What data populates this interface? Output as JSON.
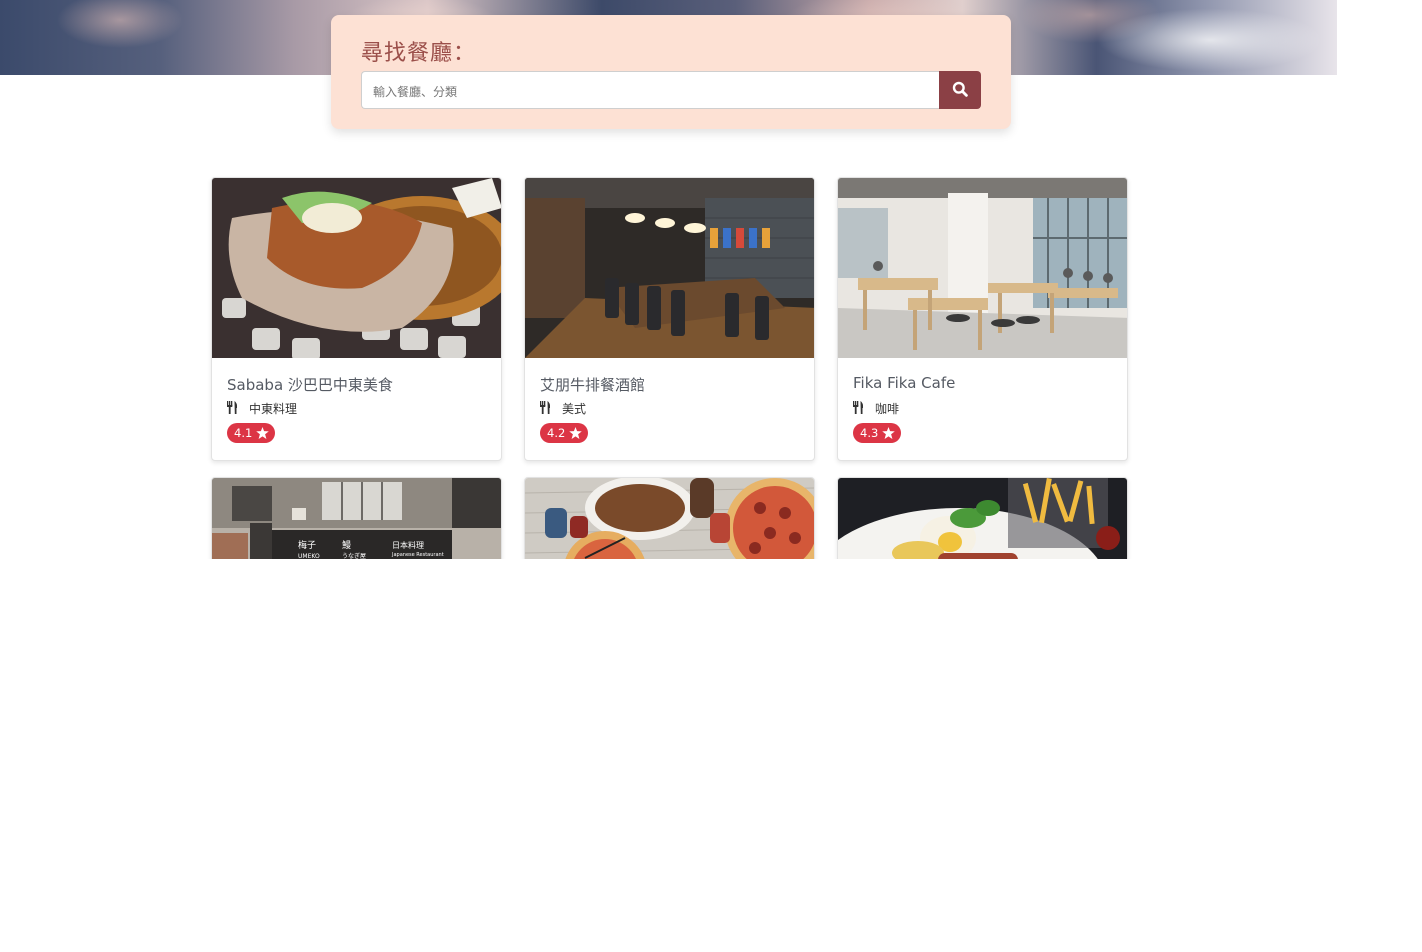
{
  "search": {
    "title": "尋找餐廳：",
    "placeholder": "輸入餐廳、分類",
    "button_icon": "search-icon"
  },
  "restaurants": [
    {
      "name": "Sababa 沙巴巴中東美食",
      "category": "中東料理",
      "rating": "4.1",
      "image": "pita-sandwich-photo"
    },
    {
      "name": "艾朋牛排餐酒館",
      "category": "美式",
      "rating": "4.2",
      "image": "restaurant-dining-room-photo"
    },
    {
      "name": "Fika Fika Cafe",
      "category": "咖啡",
      "rating": "4.3",
      "image": "cafe-interior-photo"
    },
    {
      "name": "",
      "category": "",
      "rating": "",
      "image": "umeko-storefront-photo"
    },
    {
      "name": "",
      "category": "",
      "rating": "",
      "image": "pizza-table-photo"
    },
    {
      "name": "",
      "category": "",
      "rating": "",
      "image": "breakfast-plate-photo"
    }
  ],
  "colors": {
    "panel_bg": "#fde1d4",
    "title_color": "#9b4f4a",
    "search_button": "#8b4045",
    "rating_badge": "#dc3545"
  },
  "icons": {
    "category": "utensils-icon",
    "rating": "star-icon"
  }
}
